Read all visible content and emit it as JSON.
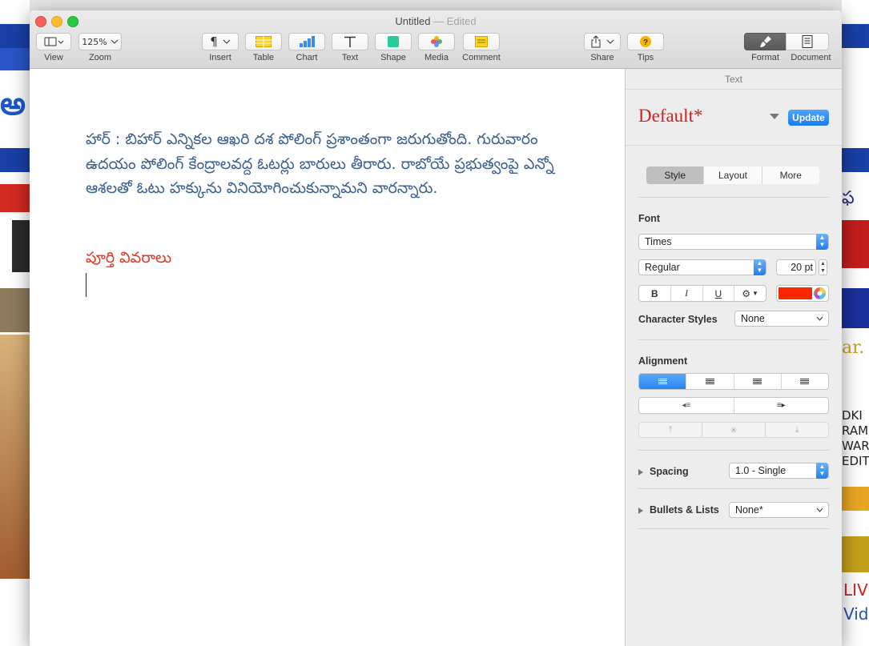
{
  "window": {
    "title": "Untitled",
    "title_sep": "—",
    "title_status": "Edited"
  },
  "toolbar": {
    "view_label": "View",
    "zoom_value": "125%",
    "zoom_label": "Zoom",
    "insert_label": "Insert",
    "table_label": "Table",
    "chart_label": "Chart",
    "text_label": "Text",
    "shape_label": "Shape",
    "media_label": "Media",
    "comment_label": "Comment",
    "share_label": "Share",
    "tips_label": "Tips",
    "format_label": "Format",
    "document_label": "Document"
  },
  "document": {
    "paragraph": "హార్ : బిహార్ ఎన్నికల ఆఖరి దశ పోలింగ్ ప్రశాంతంగా జరుగుతోంది. గురువారం ఉదయం పోలింగ్ కేంద్రాలవద్ద ఓటర్లు బారులు తీరారు. రాబోయే ప్రభుత్వంపై ఎన్నో ఆశలతో ఓటు హక్కును వినియోగించుకున్నామని వారన్నారు.",
    "link": "పూర్తి వివరాలు"
  },
  "sidebar": {
    "header": "Text",
    "style_name": "Default*",
    "update_label": "Update",
    "tabs": [
      "Style",
      "Layout",
      "More"
    ],
    "font_section": "Font",
    "font_family": "Times",
    "font_typeface": "Regular",
    "font_size": "20 pt",
    "bold": "B",
    "italic": "I",
    "underline": "U",
    "text_color": "#ff2600",
    "character_styles_label": "Character Styles",
    "character_styles_value": "None",
    "alignment_label": "Alignment",
    "spacing_label": "Spacing",
    "spacing_value": "1.0 - Single",
    "bullets_label": "Bullets & Lists",
    "bullets_value": "None*"
  },
  "colors": {
    "accent": "#2b86f0",
    "body_text": "#3a5f8f",
    "link_text": "#e3371f",
    "style_name": "#d0201f"
  }
}
